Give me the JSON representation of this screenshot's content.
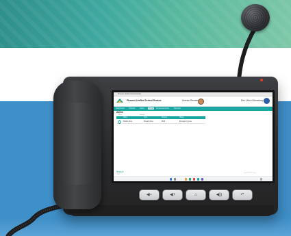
{
  "screen": {
    "browser_tab": "Phoenix Unified School District",
    "app_title": "Phoenix Unified School District",
    "user_center": "Andrew Zimmerman",
    "user_right": "Dist. Union Elementary",
    "nav_items": [
      "Dashboard",
      "Schools",
      "Users",
      "Zones",
      "Announcements",
      "Records"
    ],
    "active_nav_index": 3,
    "page_heading": "Zones",
    "subtabs": [
      "Zones",
      "Groups"
    ],
    "table": {
      "columns": [
        "",
        "Name",
        "Type",
        "Devices",
        "Status"
      ],
      "rows": [
        [
          "",
          "Stefan Zone",
          "Stream Zone",
          "Multi",
          "Emergency zone"
        ]
      ]
    },
    "footer_brand": "Onetech",
    "footer_sub": "©2025",
    "footer_right": "Privacy Policy | Terms"
  },
  "hardware_buttons": [
    {
      "name": "volume-down",
      "glyph": "◀−"
    },
    {
      "name": "volume-up",
      "glyph": "◀+"
    },
    {
      "name": "home",
      "glyph": "⌂"
    },
    {
      "name": "speaker",
      "glyph": "◀))"
    },
    {
      "name": "back",
      "glyph": "↶"
    }
  ],
  "colors": {
    "brand_teal": "#1aa6a0",
    "background_blue": "#3f8fc8",
    "background_green": "#3fa89f",
    "device_body": "#2b2c2e",
    "led_red": "#e23b2e"
  }
}
